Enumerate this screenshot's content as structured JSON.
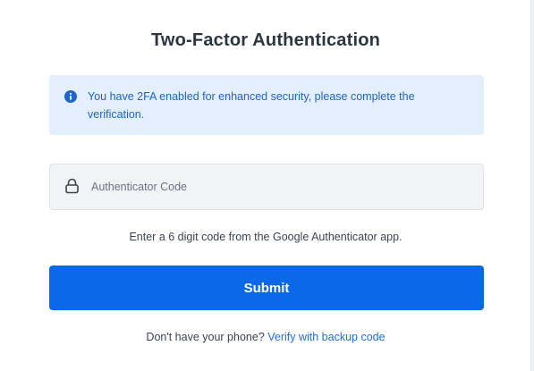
{
  "page": {
    "title": "Two-Factor Authentication"
  },
  "alert": {
    "icon": "info-icon",
    "message": "You have 2FA enabled for enhanced security, please complete the verification."
  },
  "code_field": {
    "icon": "lock-icon",
    "placeholder": "Authenticator Code",
    "value": ""
  },
  "hint": "Enter a 6 digit code from the Google Authenticator app.",
  "submit_label": "Submit",
  "backup": {
    "prompt": "Don't have your phone?",
    "link_label": "Verify with backup code"
  },
  "colors": {
    "primary": "#0b68e6",
    "alert_bg": "#e3effc",
    "alert_text": "#1f64c8",
    "link": "#1f6fd8",
    "title": "#2c3542"
  }
}
